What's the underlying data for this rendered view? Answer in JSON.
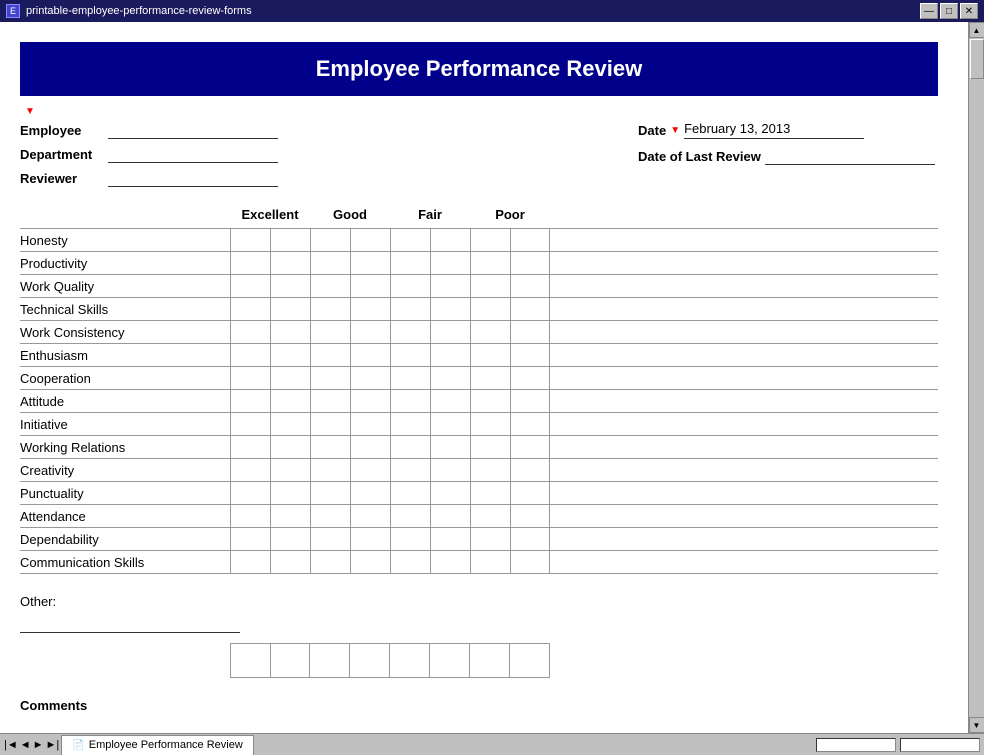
{
  "window": {
    "title": "printable-employee-performance-review-forms",
    "tab_label": "Employee Performance Review"
  },
  "title_bar": {
    "minimize": "—",
    "maximize": "□",
    "close": "✕"
  },
  "form": {
    "title": "Employee Performance Review",
    "fields": {
      "employee_label": "Employee",
      "department_label": "Department",
      "reviewer_label": "Reviewer",
      "date_label": "Date",
      "date_value": "February 13, 2013",
      "date_of_last_review_label": "Date of Last Review"
    },
    "rating_headers": [
      "Excellent",
      "Good",
      "Fair",
      "Poor"
    ],
    "criteria": [
      "Honesty",
      "Productivity",
      "Work Quality",
      "Technical Skills",
      "Work Consistency",
      "Enthusiasm",
      "Cooperation",
      "Attitude",
      "Initiative",
      "Working Relations",
      "Creativity",
      "Punctuality",
      "Attendance",
      "Dependability",
      "Communication Skills"
    ],
    "other_label": "Other:",
    "comments_label": "Comments"
  }
}
